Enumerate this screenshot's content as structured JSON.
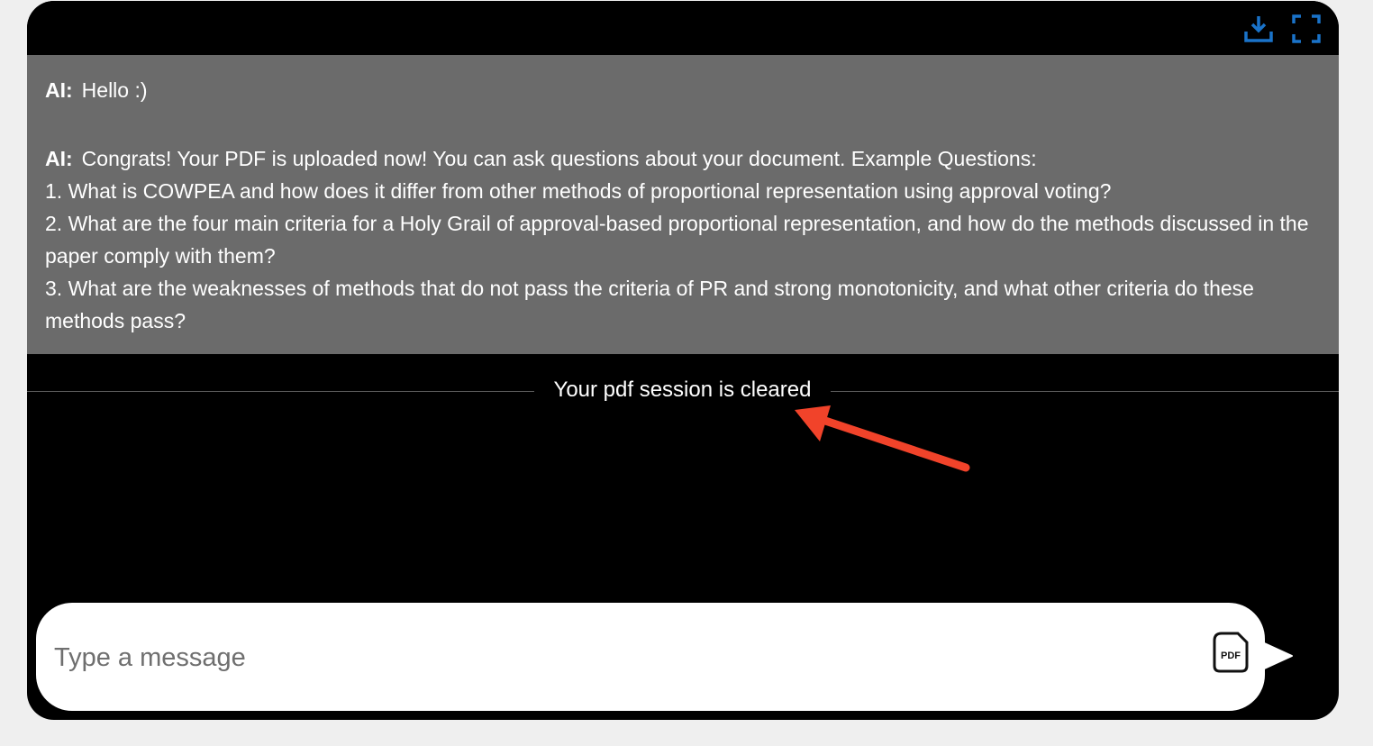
{
  "toolbar": {
    "download_icon": "download-icon",
    "fullscreen_icon": "fullscreen-icon",
    "accent_color": "#1a73c9"
  },
  "messages": [
    {
      "sender": "AI:",
      "lines": [
        "Hello :)"
      ]
    },
    {
      "sender": "AI:",
      "lines": [
        "Congrats! Your PDF is uploaded now! You can ask questions about your document. Example Questions:",
        "1. What is COWPEA and how does it differ from other methods of proportional representation using approval voting?",
        "2. What are the four main criteria for a Holy Grail of approval-based proportional representation, and how do the methods discussed in the paper comply with them?",
        "3. What are the weaknesses of methods that do not pass the criteria of PR and strong monotonicity, and what other criteria do these methods pass?"
      ]
    }
  ],
  "session_notice": "Your pdf session is cleared",
  "annotation": {
    "type": "arrow",
    "color": "#f1432a"
  },
  "composer": {
    "placeholder": "Type a message",
    "value": "",
    "pdf_icon_label": "PDF",
    "pdf_icon": "pdf-file-icon",
    "send_icon": "send-icon"
  },
  "colors": {
    "window_bg": "#000000",
    "message_panel_bg": "#6b6b6b",
    "page_bg": "#efefef"
  }
}
